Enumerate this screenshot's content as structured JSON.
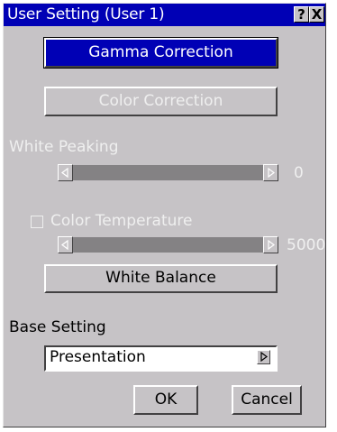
{
  "window": {
    "title": "User Setting (User 1)",
    "help_label": "?",
    "close_label": "X"
  },
  "buttons": {
    "gamma_correction": "Gamma Correction",
    "color_correction": "Color Correction",
    "white_balance": "White Balance",
    "ok": "OK",
    "cancel": "Cancel"
  },
  "white_peaking": {
    "label": "White Peaking",
    "value": "0"
  },
  "color_temperature": {
    "label": "Color Temperature",
    "value": "5000",
    "checked": false
  },
  "base_setting": {
    "label": "Base Setting",
    "selected": "Presentation"
  },
  "colors": {
    "titlebar": "#0000b5",
    "dialog": "#c6c3c6",
    "disabled_text": "#efefef"
  }
}
